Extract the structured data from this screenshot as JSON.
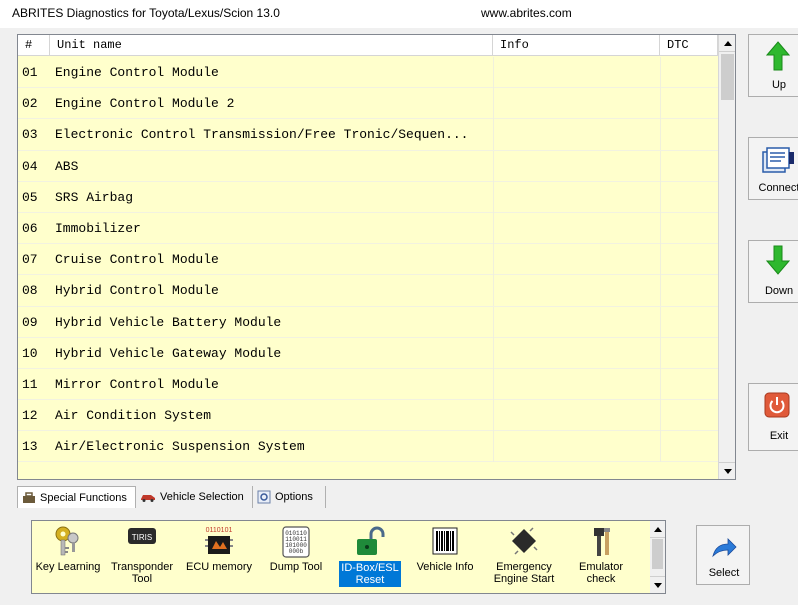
{
  "window": {
    "title": "ABRITES Diagnostics for Toyota/Lexus/Scion 13.0",
    "url": "www.abrites.com"
  },
  "table": {
    "columns": [
      "#",
      "Unit name",
      "Info",
      "DTC"
    ],
    "rows": [
      {
        "num": "01",
        "name": "Engine Control Module",
        "info": "",
        "dtc": ""
      },
      {
        "num": "02",
        "name": "Engine Control Module 2",
        "info": "",
        "dtc": ""
      },
      {
        "num": "03",
        "name": "Electronic Control Transmission/Free Tronic/Sequen...",
        "info": "",
        "dtc": ""
      },
      {
        "num": "04",
        "name": "ABS",
        "info": "",
        "dtc": ""
      },
      {
        "num": "05",
        "name": "SRS Airbag",
        "info": "",
        "dtc": ""
      },
      {
        "num": "06",
        "name": "Immobilizer",
        "info": "",
        "dtc": ""
      },
      {
        "num": "07",
        "name": "Cruise Control Module",
        "info": "",
        "dtc": ""
      },
      {
        "num": "08",
        "name": "Hybrid Control Module",
        "info": "",
        "dtc": ""
      },
      {
        "num": "09",
        "name": "Hybrid Vehicle Battery Module",
        "info": "",
        "dtc": ""
      },
      {
        "num": "10",
        "name": "Hybrid Vehicle Gateway Module",
        "info": "",
        "dtc": ""
      },
      {
        "num": "11",
        "name": "Mirror Control Module",
        "info": "",
        "dtc": ""
      },
      {
        "num": "12",
        "name": "Air Condition System",
        "info": "",
        "dtc": ""
      },
      {
        "num": "13",
        "name": "Air/Electronic Suspension System",
        "info": "",
        "dtc": ""
      }
    ]
  },
  "side_buttons": {
    "up": {
      "label": "Up",
      "icon": "green-up-arrow-icon"
    },
    "connect": {
      "label": "Connect",
      "icon": "connect-document-icon"
    },
    "down": {
      "label": "Down",
      "icon": "green-down-arrow-icon"
    },
    "exit": {
      "label": "Exit",
      "icon": "power-icon"
    }
  },
  "tabs": [
    {
      "label": "Special Functions",
      "icon": "toolbox-icon",
      "active": true
    },
    {
      "label": "Vehicle Selection",
      "icon": "car-icon",
      "active": false
    },
    {
      "label": "Options",
      "icon": "options-gear-icon",
      "active": false
    }
  ],
  "functions": [
    {
      "label": "Key Learning",
      "icon": "keys-icon"
    },
    {
      "label": "Transponder Tool",
      "icon": "transponder-chip-icon"
    },
    {
      "label": "ECU memory",
      "icon": "ecu-memory-icon",
      "icon_text": "0110101"
    },
    {
      "label": "Dump Tool",
      "icon": "dump-binary-icon",
      "icon_text": "010110 110011 101000 000b"
    },
    {
      "label": "ID-Box/ESL Reset",
      "icon": "unlock-padlock-icon",
      "selected": true
    },
    {
      "label": "Vehicle Info",
      "icon": "barcode-icon"
    },
    {
      "label": "Emergency Engine Start",
      "icon": "chip-icon"
    },
    {
      "label": "Emulator check",
      "icon": "emulator-tools-icon"
    }
  ],
  "select_button": {
    "label": "Select",
    "icon": "blue-arrow-icon"
  },
  "colors": {
    "table_bg": "#ffffcc",
    "accent_green": "#2eb82e",
    "selected_blue": "#0078d7",
    "exit_red": "#e05a3a"
  }
}
